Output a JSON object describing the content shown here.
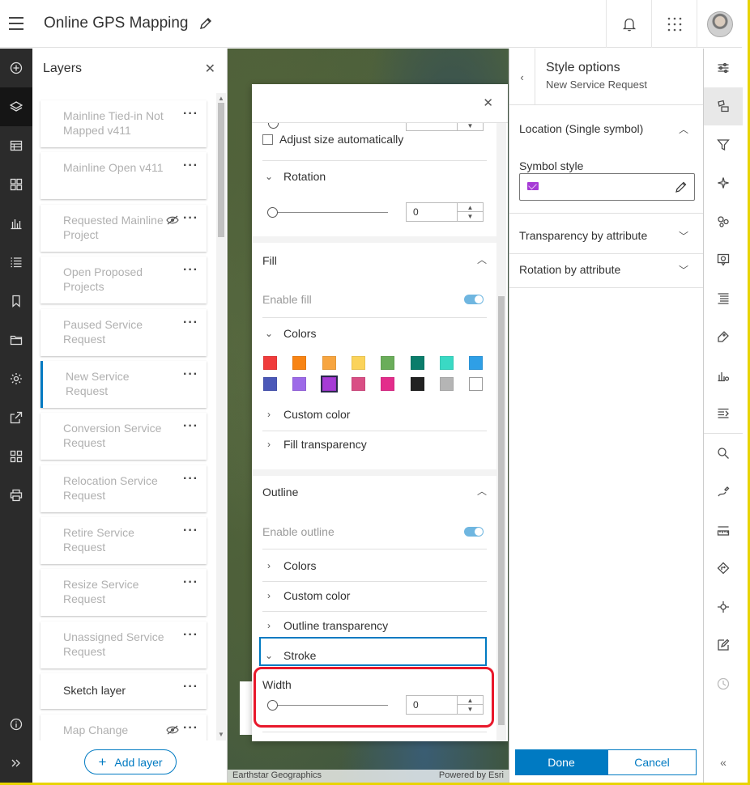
{
  "header": {
    "title": "Online GPS Mapping"
  },
  "layers_panel": {
    "title": "Layers",
    "add_layer_label": "Add layer",
    "items": [
      {
        "name": "Mainline Tied-in Not Mapped v411",
        "visible": false
      },
      {
        "name": "Mainline Open v411",
        "visible": false
      },
      {
        "name": "Requested Mainline Project",
        "visible": false,
        "eye": true
      },
      {
        "name": "Open Proposed Projects",
        "visible": false
      },
      {
        "name": "Paused Service Request",
        "visible": false
      },
      {
        "name": "New Service Request",
        "visible": false,
        "selected": true
      },
      {
        "name": "Conversion Service Request",
        "visible": false
      },
      {
        "name": "Relocation Service Request",
        "visible": false
      },
      {
        "name": "Retire Service Request",
        "visible": false
      },
      {
        "name": "Resize Service Request",
        "visible": false
      },
      {
        "name": "Unassigned Service Request",
        "visible": false
      },
      {
        "name": "Sketch layer",
        "visible": true
      },
      {
        "name": "Map Change Request",
        "visible": false,
        "eye": true
      }
    ]
  },
  "map": {
    "attribution_left": "Earthstar Geographics",
    "attribution_right": "Powered by Esri"
  },
  "symbol_popover": {
    "adjust_size_label": "Adjust size automatically",
    "rotation_label": "Rotation",
    "rotation_value": "0",
    "fill_title": "Fill",
    "enable_fill_label": "Enable fill",
    "fill_colors_label": "Colors",
    "custom_color_label": "Custom color",
    "fill_transparency_label": "Fill transparency",
    "outline_title": "Outline",
    "enable_outline_label": "Enable outline",
    "outline_colors_label": "Colors",
    "outline_custom_color_label": "Custom color",
    "outline_transparency_label": "Outline transparency",
    "stroke_label": "Stroke",
    "width_label": "Width",
    "width_value": "0",
    "swatches": [
      "#f03c3c",
      "#f88414",
      "#f7a540",
      "#fbd35a",
      "#6aad5a",
      "#0b7d6b",
      "#3ad9c4",
      "#2f9fe6",
      "#4b58b8",
      "#9d6ae8",
      "#a63bd6",
      "#d94f85",
      "#e32d8b",
      "#222222",
      "#b5b5b5",
      "#ffffff"
    ],
    "selected_swatch": 10
  },
  "style_panel": {
    "title": "Style options",
    "subtitle": "New Service Request",
    "location_label": "Location (Single symbol)",
    "symbol_style_label": "Symbol style",
    "transparency_label": "Transparency by attribute",
    "rotation_label": "Rotation by attribute",
    "done_label": "Done",
    "cancel_label": "Cancel"
  },
  "colors": {
    "accent": "#007ac2",
    "highlight": "#e8182b"
  }
}
